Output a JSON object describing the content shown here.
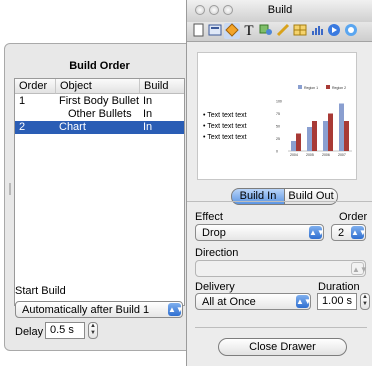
{
  "build_order": {
    "title": "Build Order",
    "columns": [
      "Order",
      "Object",
      "Build"
    ],
    "rows": [
      {
        "order": "1",
        "object": "First Body Bullet",
        "build": "In"
      },
      {
        "order": "",
        "object": "Other Bullets",
        "build": "In"
      },
      {
        "order": "2",
        "object": "Chart",
        "build": "In"
      }
    ],
    "start_build_label": "Start Build",
    "start_build_value": "Automatically after Build 1",
    "delay_label": "Delay",
    "delay_value": "0.5 s"
  },
  "build_window": {
    "title": "Build",
    "toolbar_icons": [
      "document-icon",
      "slide-layout-icon",
      "build-icon",
      "text-icon",
      "graphic-icon",
      "metrics-icon",
      "table-icon",
      "chart-icon",
      "link-icon",
      "quicktime-icon"
    ],
    "preview": {
      "bullets": [
        "Text text text",
        "Text text text",
        "Text text text"
      ],
      "legend": [
        "Region 1",
        "Region 2"
      ],
      "years": [
        "2004",
        "2005",
        "2006",
        "2007"
      ],
      "yticks": [
        "100",
        "75",
        "50",
        "25",
        "0"
      ]
    },
    "tab_build_in": "Build In",
    "tab_build_out": "Build Out",
    "effect_label": "Effect",
    "effect_value": "Drop",
    "order_label": "Order",
    "order_value": "2",
    "direction_label": "Direction",
    "direction_value": "",
    "delivery_label": "Delivery",
    "delivery_value": "All at Once",
    "duration_label": "Duration",
    "duration_value": "1.00 s",
    "close_button": "Close Drawer"
  },
  "colors": {
    "selection": "#2a5db5",
    "accent_blue": "#3a78d6",
    "series1": "#8a9fd0",
    "series2": "#a83a36"
  },
  "chart_data": {
    "type": "bar",
    "categories": [
      "2004",
      "2005",
      "2006",
      "2007"
    ],
    "series": [
      {
        "name": "Region 1",
        "values": [
          20,
          48,
          60,
          95
        ]
      },
      {
        "name": "Region 2",
        "values": [
          35,
          60,
          75,
          60
        ]
      }
    ],
    "ylim": [
      0,
      100
    ]
  }
}
